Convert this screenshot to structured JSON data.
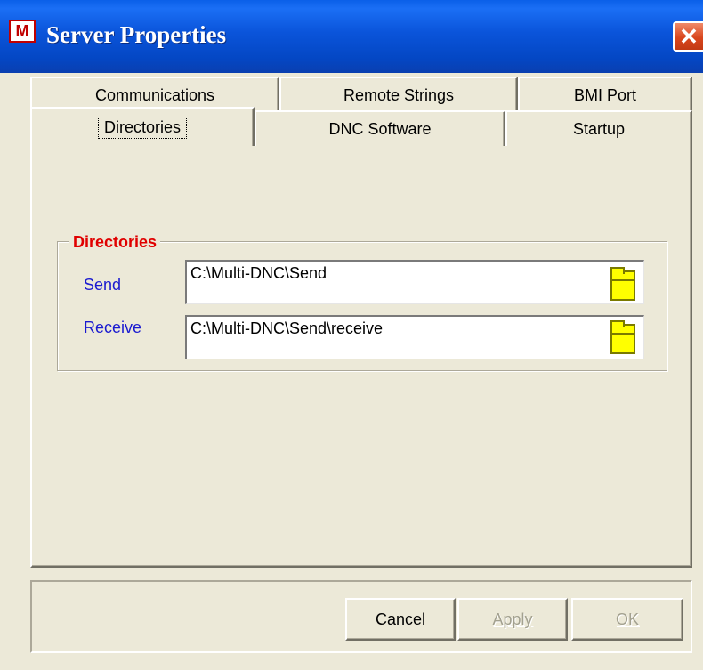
{
  "window": {
    "title": "Server Properties",
    "icon": "multi-dnc-logo-icon",
    "close_glyph": "✕"
  },
  "tabs": {
    "row_back": [
      "Communications",
      "Remote Strings",
      "BMI Port"
    ],
    "row_front": [
      "Directories",
      "DNC Software",
      "Startup"
    ],
    "active": "Directories"
  },
  "directories": {
    "group_title": "Directories",
    "send_label": "Send",
    "send_path": "C:\\Multi-DNC\\Send",
    "receive_label": "Receive",
    "receive_path": "C:\\Multi-DNC\\Send\\receive"
  },
  "buttons": {
    "cancel": "Cancel",
    "apply": "Apply",
    "ok": "OK"
  },
  "colors": {
    "titlebar": "#0a54da",
    "group_title": "#e00000",
    "field_labels": "#1a1ad0",
    "folder_icon": "#ffff00"
  }
}
